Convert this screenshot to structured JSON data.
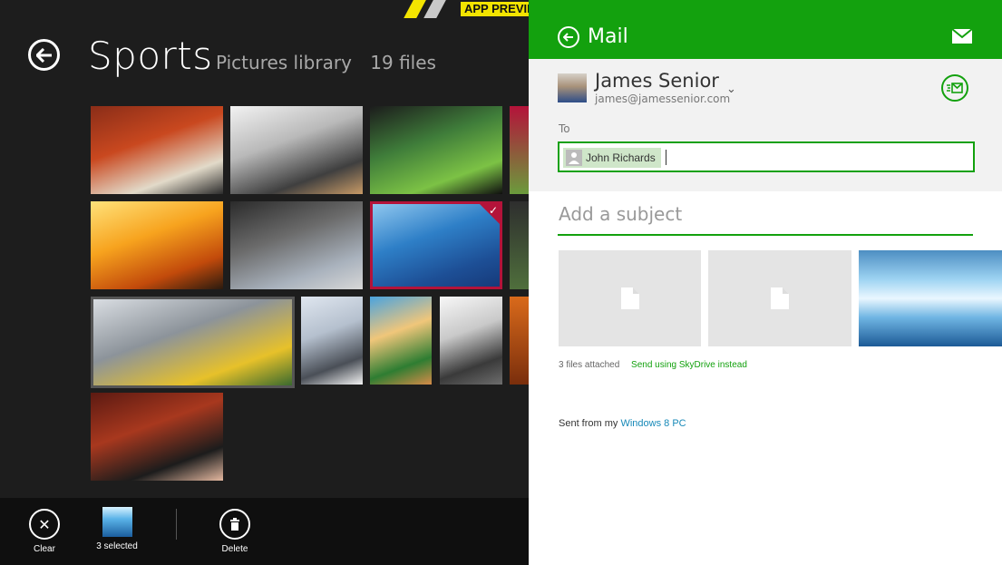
{
  "left_app": {
    "banner_text": "APP PREVIEW",
    "title": "Sports",
    "subtitle_location": "Pictures library",
    "subtitle_count": "19 files",
    "thumbnails": [
      {
        "name": "track-runners",
        "selected": false,
        "colors": [
          "#8a2d18",
          "#c9481f",
          "#e2dac9",
          "#2b2b2b"
        ]
      },
      {
        "name": "business-meeting",
        "selected": false,
        "colors": [
          "#f2f2f2",
          "#b9b9b9",
          "#3f3f3f",
          "#c79a66"
        ]
      },
      {
        "name": "stadium-crowd",
        "selected": false,
        "colors": [
          "#1c1c1c",
          "#3f7d3a",
          "#7cc245",
          "#0f0f0f"
        ]
      },
      {
        "name": "football-partial",
        "selected": false,
        "colors": [
          "#b4133a",
          "#6b9b3c"
        ]
      },
      {
        "name": "archer-sunset",
        "selected": false,
        "colors": [
          "#ffe27a",
          "#f7a31e",
          "#c24a0b",
          "#2a1a0e"
        ]
      },
      {
        "name": "camera-operator",
        "selected": false,
        "colors": [
          "#2b2b2b",
          "#6b6b6b",
          "#a9b2bd",
          "#d7d7d7"
        ]
      },
      {
        "name": "swimmer",
        "selected": true,
        "colors": [
          "#8fc7ef",
          "#2e7fc7",
          "#1d4f96",
          "#163a7a"
        ]
      },
      {
        "name": "stadium-partial",
        "selected": false,
        "colors": [
          "#2e2e2e",
          "#4f6f3c"
        ]
      },
      {
        "name": "soccer-bicycle-kick",
        "selected": false,
        "colors": [
          "#d9dde2",
          "#8c939a",
          "#e7c12a",
          "#3a6a2e"
        ]
      },
      {
        "name": "capitol-steps",
        "selected": false,
        "colors": [
          "#dfe6ef",
          "#b5c0ce",
          "#4a4f57",
          "#f2f2f2"
        ]
      },
      {
        "name": "tennis-player",
        "selected": false,
        "colors": [
          "#4aa3df",
          "#f0c67a",
          "#2e7d32",
          "#d58b48"
        ]
      },
      {
        "name": "handshake",
        "selected": false,
        "colors": [
          "#f7f7f7",
          "#c9c9c9",
          "#3a3a3a",
          "#6d6d6d"
        ]
      },
      {
        "name": "orange-partial",
        "selected": false,
        "colors": [
          "#d96a1b",
          "#7a2e0c"
        ]
      },
      {
        "name": "speaker-podium",
        "selected": false,
        "colors": [
          "#5c1a12",
          "#a8381e",
          "#1c1c1c",
          "#e4b8a0"
        ]
      }
    ],
    "appbar": {
      "clear_label": "Clear",
      "selected_label": "3 selected",
      "delete_label": "Delete"
    }
  },
  "mail": {
    "title": "Mail",
    "from_name": "James Senior",
    "from_email": "james@jamessenior.com",
    "to_label": "To",
    "recipient": "John Richards",
    "subject_placeholder": "Add a subject",
    "files_attached": "3 files attached",
    "skydrive_link": "Send using SkyDrive instead",
    "signature_prefix": "Sent from my",
    "signature_link": "Windows 8 PC"
  },
  "colors": {
    "mail_green": "#13a10e",
    "selection_red": "#b4133a",
    "link_blue": "#1789b8"
  }
}
